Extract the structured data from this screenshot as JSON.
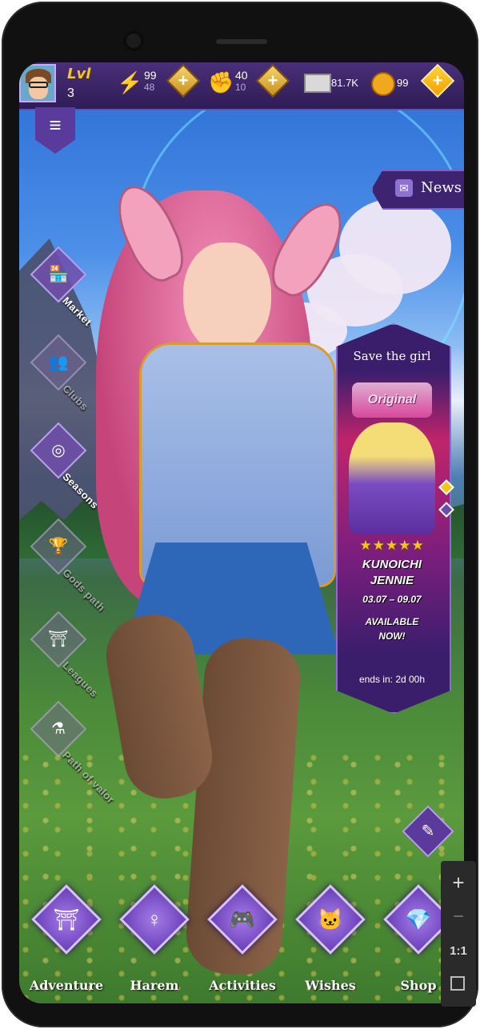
{
  "topbar": {
    "level_label": "Lvl",
    "level_value": "3",
    "energy": {
      "main": "99",
      "sub": "48"
    },
    "fights": {
      "main": "40",
      "sub": "10"
    },
    "money": "81.7K",
    "koban": "99"
  },
  "side_nav": {
    "market": "Market",
    "clubs": "Clubs",
    "seasons": "Seasons",
    "gods_path": "Gods path",
    "leagues": "Leagues",
    "path_of_valor": "Path of valor"
  },
  "news": {
    "label": "News"
  },
  "event": {
    "title": "Save the girl",
    "logo": "Original",
    "rating": "★★★★★",
    "name_line1": "KUNOICHI",
    "name_line2": "JENNIE",
    "dates": "03.07 – 09.07",
    "available_line1": "AVAILABLE",
    "available_line2": "NOW!",
    "ends": "ends in: 2d 00h"
  },
  "bottom_nav": {
    "adventure": "Adventure",
    "harem": "Harem",
    "activities": "Activities",
    "wishes": "Wishes",
    "shop": "Shop"
  },
  "zoom": {
    "plus": "+",
    "minus": "−",
    "ratio": "1:1"
  }
}
